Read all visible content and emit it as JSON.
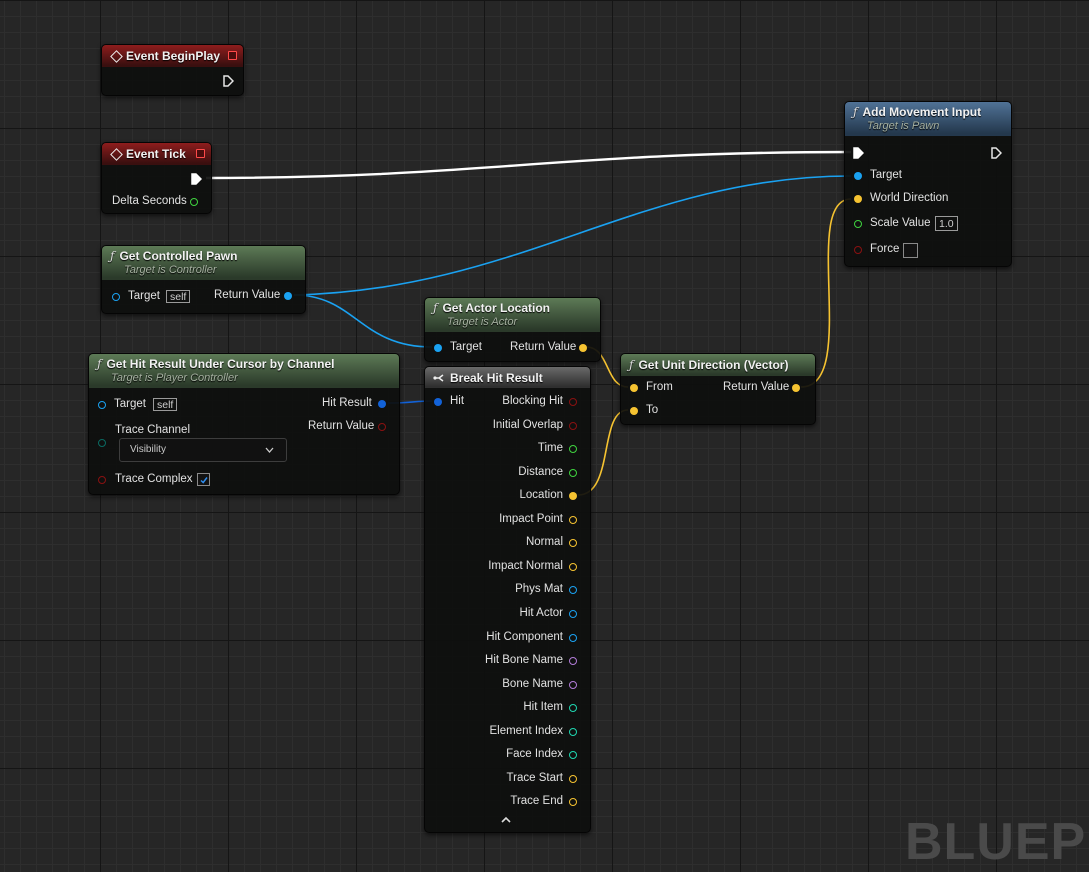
{
  "graph": {
    "watermark": "BLUEPR",
    "nodes": {
      "begin_play": {
        "title": "Event BeginPlay"
      },
      "event_tick": {
        "title": "Event Tick",
        "delta_seconds": "Delta Seconds"
      },
      "get_controlled_pawn": {
        "title": "Get Controlled Pawn",
        "subtitle": "Target is Controller",
        "target_label": "Target",
        "target_default": "self",
        "return_label": "Return Value"
      },
      "get_hit_result": {
        "title": "Get Hit Result Under Cursor by Channel",
        "subtitle": "Target is Player Controller",
        "target_label": "Target",
        "target_default": "self",
        "trace_channel_label": "Trace Channel",
        "trace_channel_value": "Visibility",
        "trace_complex_label": "Trace Complex",
        "trace_complex_checked": true,
        "hit_result_label": "Hit Result",
        "return_label": "Return Value"
      },
      "get_actor_location": {
        "title": "Get Actor Location",
        "subtitle": "Target is Actor",
        "target_label": "Target",
        "return_label": "Return Value"
      },
      "break_hit_result": {
        "title": "Break Hit Result",
        "hit_label": "Hit",
        "outputs": [
          "Blocking Hit",
          "Initial Overlap",
          "Time",
          "Distance",
          "Location",
          "Impact Point",
          "Normal",
          "Impact Normal",
          "Phys Mat",
          "Hit Actor",
          "Hit Component",
          "Hit Bone Name",
          "Bone Name",
          "Hit Item",
          "Element Index",
          "Face Index",
          "Trace Start",
          "Trace End"
        ]
      },
      "get_unit_direction": {
        "title": "Get Unit Direction (Vector)",
        "from_label": "From",
        "to_label": "To",
        "return_label": "Return Value"
      },
      "add_movement_input": {
        "title": "Add Movement Input",
        "subtitle": "Target is Pawn",
        "target_label": "Target",
        "world_direction_label": "World Direction",
        "scale_value_label": "Scale Value",
        "scale_value": "1.0",
        "force_label": "Force"
      }
    }
  },
  "colors": {
    "object": "#1aa2f2",
    "vector": "#f6c331",
    "bool": "#8a1111",
    "float": "#3fd33f",
    "name": "#b27cd8",
    "int": "#1fd7b0",
    "struct": "#0a5fd8",
    "enum": "#0a6a62",
    "exec": "#ffffff"
  }
}
